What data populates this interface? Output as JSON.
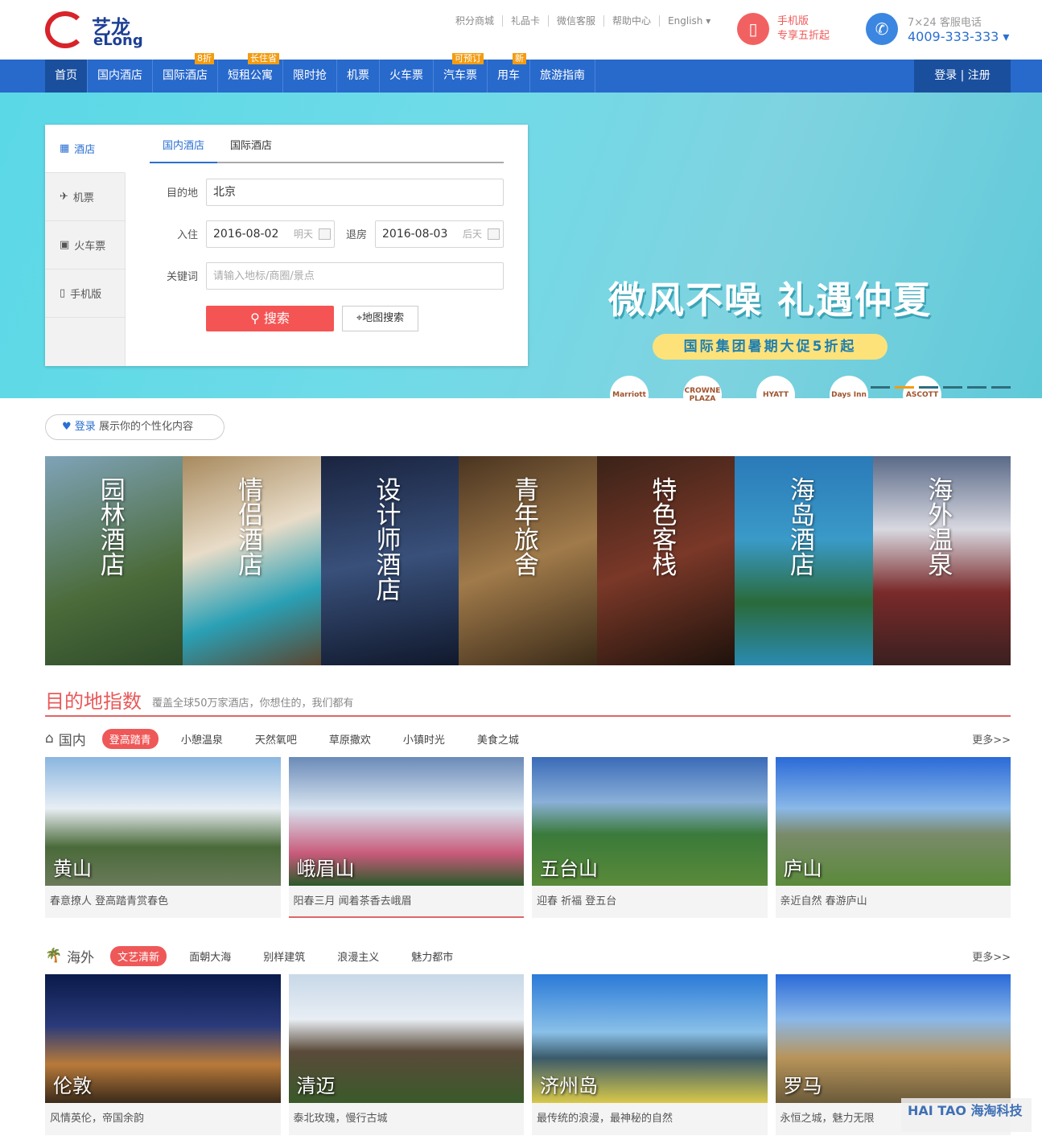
{
  "header": {
    "logo_cn": "艺龙",
    "logo_en": "eLong",
    "links": [
      "积分商城",
      "礼品卡",
      "微信客服",
      "帮助中心",
      "English ▾"
    ],
    "mobile_line1": "手机版",
    "mobile_line2": "专享五折起",
    "phone_label": "7×24 客服电话",
    "phone": "4009-333-333 ▾"
  },
  "nav": {
    "items": [
      {
        "label": "首页",
        "tag": ""
      },
      {
        "label": "国内酒店",
        "tag": ""
      },
      {
        "label": "国际酒店",
        "tag": "8折"
      },
      {
        "label": "短租公寓",
        "tag": "长住省"
      },
      {
        "label": "限时抢",
        "tag": ""
      },
      {
        "label": "机票",
        "tag": ""
      },
      {
        "label": "火车票",
        "tag": ""
      },
      {
        "label": "汽车票",
        "tag": "可预订"
      },
      {
        "label": "用车",
        "tag": "新"
      },
      {
        "label": "旅游指南",
        "tag": ""
      }
    ],
    "login": "登录 | 注册"
  },
  "search": {
    "side": [
      "酒店",
      "机票",
      "火车票",
      "手机版"
    ],
    "tabs": [
      "国内酒店",
      "国际酒店"
    ],
    "dest_label": "目的地",
    "dest_value": "北京",
    "checkin_label": "入住",
    "checkin_value": "2016-08-02",
    "checkin_hint": "明天",
    "checkout_label": "退房",
    "checkout_value": "2016-08-03",
    "checkout_hint": "后天",
    "keyword_label": "关键词",
    "keyword_placeholder": "请输入地标/商圈/景点",
    "search_button": "搜索",
    "map_button": "地图搜索"
  },
  "banner": {
    "slogan": "微风不噪 礼遇仲夏",
    "subtitle": "国际集团暑期大促5折起",
    "brands": [
      "Marriott",
      "CROWNE PLAZA",
      "HYATT",
      "Days Inn",
      "ASCOTT"
    ],
    "slides": 6,
    "active_slide": 2
  },
  "login_prompt": {
    "link": "登录",
    "text": " 展示你的个性化内容"
  },
  "themes": [
    "园林酒店",
    "情侣酒店",
    "设计师酒店",
    "青年旅舍",
    "特色客栈",
    "海岛酒店",
    "海外温泉"
  ],
  "destinations": {
    "title": "目的地指数",
    "subtitle": "覆盖全球50万家酒店，你想住的，我们都有",
    "more": "更多>>",
    "domestic": {
      "name": "国内",
      "cats": [
        "登高踏青",
        "小憩温泉",
        "天然氧吧",
        "草原撒欢",
        "小镇时光",
        "美食之城"
      ],
      "cards": [
        {
          "city": "黄山",
          "desc": "春意撩人 登高踏青赏春色"
        },
        {
          "city": "峨眉山",
          "desc": "阳春三月 闻着茶香去峨眉"
        },
        {
          "city": "五台山",
          "desc": "迎春 祈福 登五台"
        },
        {
          "city": "庐山",
          "desc": "亲近自然 春游庐山"
        }
      ]
    },
    "overseas": {
      "name": "海外",
      "cats": [
        "文艺清新",
        "面朝大海",
        "别样建筑",
        "浪漫主义",
        "魅力都市"
      ],
      "cards": [
        {
          "city": "伦敦",
          "desc": "风情英伦，帝国余韵"
        },
        {
          "city": "清迈",
          "desc": "泰北玫瑰，慢行古城"
        },
        {
          "city": "济州岛",
          "desc": "最传统的浪漫，最神秘的自然"
        },
        {
          "city": "罗马",
          "desc": "永恒之城，魅力无限"
        }
      ]
    }
  },
  "watermark": "HAI TAO 海淘科技",
  "colors": {
    "nav": "#2869cc",
    "accent_red": "#f55454",
    "link_blue": "#2a6fd2"
  }
}
